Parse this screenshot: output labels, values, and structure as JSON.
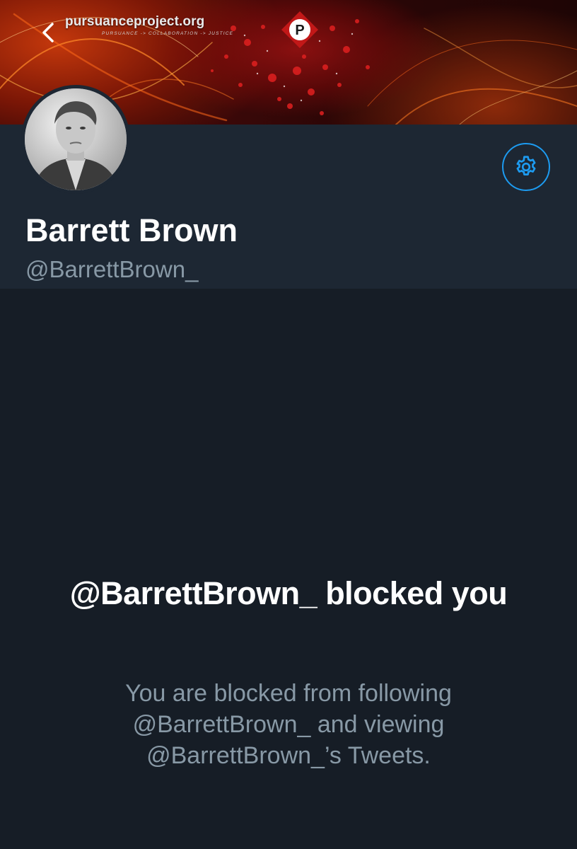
{
  "banner": {
    "site": "pursuanceproject.org",
    "tagline": "PURSUANCE -> COLLABORATION -> JUSTICE",
    "badge_letter": "P"
  },
  "icons": {
    "back": "chevron-left-icon",
    "settings": "gear-icon"
  },
  "colors": {
    "accent": "#1d9bf0",
    "background": "#161d26",
    "header_background": "#1d2733",
    "secondary_text": "#8899a6"
  },
  "profile": {
    "name": "Barrett Brown",
    "handle": "@BarrettBrown_"
  },
  "blocked": {
    "title": "@BarrettBrown_ blocked you",
    "description": "You are blocked from following @BarrettBrown_ and viewing @BarrettBrown_’s Tweets."
  }
}
